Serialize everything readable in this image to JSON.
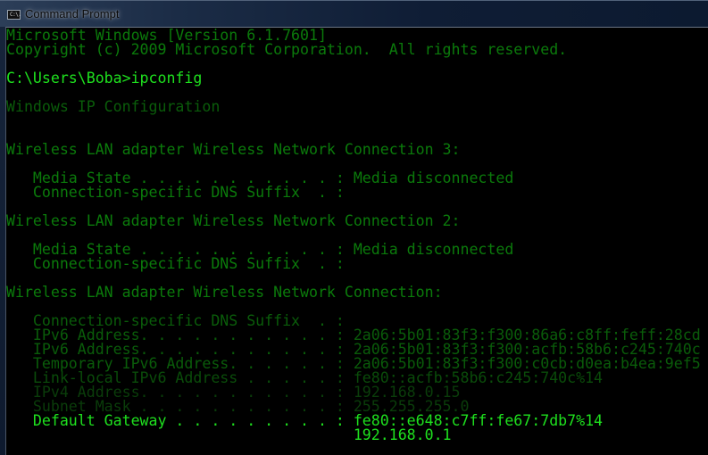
{
  "window": {
    "title": "Command Prompt",
    "icon": "console-icon",
    "icon_label": "C:\\."
  },
  "console": {
    "lines": [
      {
        "text": "Microsoft Windows [Version 6.1.7601]",
        "tone": "dim"
      },
      {
        "text": "Copyright (c) 2009 Microsoft Corporation.  All rights reserved.",
        "tone": "dim"
      },
      {
        "text": "",
        "tone": "dim"
      },
      {
        "text": "C:\\Users\\Boba>ipconfig",
        "tone": "bright"
      },
      {
        "text": "",
        "tone": "dim"
      },
      {
        "text": "Windows IP Configuration",
        "tone": "mid"
      },
      {
        "text": "",
        "tone": "dim"
      },
      {
        "text": "",
        "tone": "dim"
      },
      {
        "text": "Wireless LAN adapter Wireless Network Connection 3:",
        "tone": "dim"
      },
      {
        "text": "",
        "tone": "dim"
      },
      {
        "text": "   Media State . . . . . . . . . . . : Media disconnected",
        "tone": "dim"
      },
      {
        "text": "   Connection-specific DNS Suffix  . :",
        "tone": "dim"
      },
      {
        "text": "",
        "tone": "dim"
      },
      {
        "text": "Wireless LAN adapter Wireless Network Connection 2:",
        "tone": "dim"
      },
      {
        "text": "",
        "tone": "dim"
      },
      {
        "text": "   Media State . . . . . . . . . . . : Media disconnected",
        "tone": "dim"
      },
      {
        "text": "   Connection-specific DNS Suffix  . :",
        "tone": "dim"
      },
      {
        "text": "",
        "tone": "dim"
      },
      {
        "text": "Wireless LAN adapter Wireless Network Connection:",
        "tone": "dim"
      },
      {
        "text": "",
        "tone": "dim"
      },
      {
        "text": "   Connection-specific DNS Suffix  . :",
        "tone": "mid"
      },
      {
        "text": "   IPv6 Address. . . . . . . . . . . : 2a06:5b01:83f3:f300:86a6:c8ff:feff:28cd",
        "tone": "mid"
      },
      {
        "text": "   IPv6 Address. . . . . . . . . . . : 2a06:5b01:83f3:f300:acfb:58b6:c245:740c",
        "tone": "mid"
      },
      {
        "text": "   Temporary IPv6 Address. . . . . . : 2a06:5b01:83f3:f300:c0cb:d0ea:b4ea:9ef5",
        "tone": "mid"
      },
      {
        "text": "   Link-local IPv6 Address . . . . . : fe80::acfb:58b6:c245:740c%14",
        "tone": "dark"
      },
      {
        "text": "   IPv4 Address. . . . . . . . . . . : 192.168.0.15",
        "tone": "darker"
      },
      {
        "text": "   Subnet Mask . . . . . . . . . . . : 255.255.255.0",
        "tone": "darker"
      },
      {
        "text": "   Default Gateway . . . . . . . . . : fe80::e648:c7ff:fe67:7db7%14",
        "tone": "bright"
      },
      {
        "text": "                                       192.168.0.1",
        "tone": "bright"
      }
    ]
  },
  "colors": {
    "bright": "#1ee01e",
    "dim": "#0b7a0b",
    "mid": "#0a5c0a",
    "dark": "#0a4c0a",
    "darker": "#0a3d0a",
    "background": "#000000"
  }
}
